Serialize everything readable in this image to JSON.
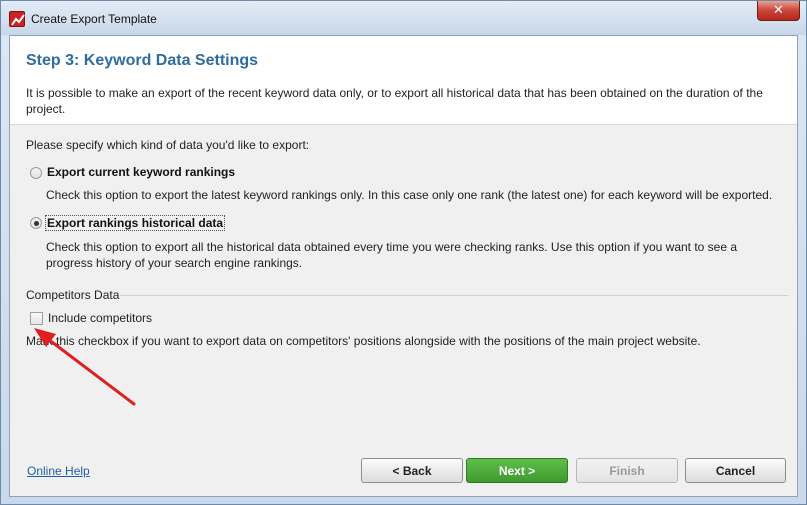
{
  "window": {
    "title": "Create Export Template",
    "close_glyph": "✕"
  },
  "step": {
    "title": "Step 3: Keyword Data Settings",
    "description": "It is possible to make an export of the recent keyword data only, or to export all historical data that has been obtained on the duration of the project."
  },
  "export_type": {
    "prompt": "Please specify which kind of data you'd like to export:",
    "options": [
      {
        "label": "Export current keyword rankings",
        "description": "Check this option to export the latest keyword rankings only. In this case only one rank (the latest one) for each keyword will be exported.",
        "selected": false
      },
      {
        "label": "Export rankings historical data",
        "description": "Check this option to export all the historical data obtained every time you were checking ranks. Use this option if you want to see a progress history of your search engine rankings.",
        "selected": true
      }
    ]
  },
  "competitors": {
    "group_label": "Competitors Data",
    "checkbox_label": "Include competitors",
    "checked": false,
    "description": "Mark this checkbox if you want to export data on competitors' positions alongside with the positions of the main project website."
  },
  "footer": {
    "help_link": "Online Help",
    "back": "< Back",
    "next": "Next >",
    "finish": "Finish",
    "cancel": "Cancel"
  },
  "colors": {
    "step_title": "#2f6c9f",
    "next_button": "#3f9a2e",
    "annotation_arrow": "#e02020"
  }
}
